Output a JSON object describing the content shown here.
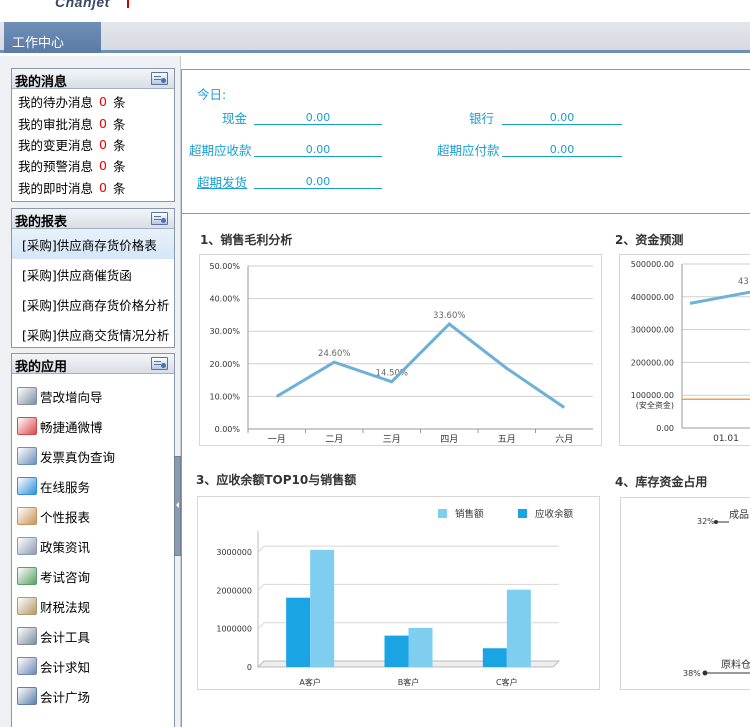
{
  "app": {
    "logo": "Chanjet",
    "tab": "工作中心"
  },
  "messages": {
    "title": "我的消息",
    "items": [
      {
        "label": "我的待办消息",
        "count": "0",
        "unit": "条"
      },
      {
        "label": "我的审批消息",
        "count": "0",
        "unit": "条"
      },
      {
        "label": "我的变更消息",
        "count": "0",
        "unit": "条"
      },
      {
        "label": "我的预警消息",
        "count": "0",
        "unit": "条"
      },
      {
        "label": "我的即时消息",
        "count": "0",
        "unit": "条"
      }
    ]
  },
  "reports": {
    "title": "我的报表",
    "items": [
      "[采购]供应商存货价格表",
      "[采购]供应商催货函",
      "[采购]供应商存货价格分析",
      "[采购]供应商交货情况分析"
    ]
  },
  "apps": {
    "title": "我的应用",
    "items": [
      {
        "label": "营改增向导",
        "icon": "wizard-icon",
        "color": "#7f8fa3"
      },
      {
        "label": "畅捷通微博",
        "icon": "weibo-icon",
        "color": "#d9474a"
      },
      {
        "label": "发票真伪查询",
        "icon": "magnifier-icon",
        "color": "#6b8fb8"
      },
      {
        "label": "在线服务",
        "icon": "chat-bubble-icon",
        "color": "#2f8fd8"
      },
      {
        "label": "个性报表",
        "icon": "report-icon",
        "color": "#c7945a"
      },
      {
        "label": "政策资讯",
        "icon": "news-icon",
        "color": "#8a9bb0"
      },
      {
        "label": "考试咨询",
        "icon": "people-icon",
        "color": "#5aa064"
      },
      {
        "label": "财税法规",
        "icon": "book-icon",
        "color": "#b09a6a"
      },
      {
        "label": "会计工具",
        "icon": "calculator-icon",
        "color": "#7d8d9f"
      },
      {
        "label": "会计求知",
        "icon": "student-icon",
        "color": "#6f88b8"
      },
      {
        "label": "会计广场",
        "icon": "square-icon",
        "color": "#5f7fa8"
      }
    ]
  },
  "summary": {
    "today_label": "今日:",
    "fields": {
      "cash": {
        "label": "现金",
        "value": "0.00"
      },
      "bank": {
        "label": "银行",
        "value": "0.00"
      },
      "overdue_receivable": {
        "label": "超期应收款",
        "value": "0.00"
      },
      "overdue_payable": {
        "label": "超期应付款",
        "value": "0.00"
      },
      "overdue_delivery": {
        "label": "超期发货",
        "value": "0.00"
      }
    }
  },
  "chart_titles": [
    "1、销售毛利分析",
    "2、资金预测",
    "3、应收余额TOP10与销售额",
    "4、库存资金占用"
  ],
  "colors": {
    "accent": "#1a9dd0",
    "header": "#5b7aa6",
    "count": "#e00000"
  },
  "chart_data": [
    {
      "type": "line",
      "title": "1、销售毛利分析",
      "categories": [
        "一月",
        "二月",
        "三月",
        "四月",
        "五月",
        "六月"
      ],
      "values": [
        10.0,
        20.5,
        14.5,
        32.2,
        18.6,
        6.6
      ],
      "labels": [
        "",
        "24.60%",
        "14.50%",
        "33.60%",
        "",
        ""
      ],
      "yticks": [
        "0.00%",
        "10.00%",
        "20.00%",
        "30.00%",
        "40.00%",
        "50.00%"
      ],
      "ylim": [
        0,
        50
      ],
      "color": "#6fb0d8",
      "grid": true
    },
    {
      "type": "line",
      "title": "2、资金预测",
      "categories": [
        "01.01"
      ],
      "yticks": [
        "0.00",
        "100000.00",
        "200000.00",
        "300000.00",
        "400000.00",
        "500000.00"
      ],
      "ylim": [
        0,
        500000
      ],
      "safety_label": "(安全资金)",
      "safety_value": 100000,
      "series_values": [
        380000,
        420000
      ],
      "point_label": "43",
      "grid": true
    },
    {
      "type": "bar",
      "title": "3、应收余额TOP10与销售额",
      "categories": [
        "A客户",
        "B客户",
        "C客户"
      ],
      "series": [
        {
          "name": "应收余额",
          "values": [
            1810000,
            820000,
            490000
          ],
          "color": "#1aa4e3"
        },
        {
          "name": "销售额",
          "values": [
            3060000,
            1020000,
            2020000
          ],
          "color": "#7fcef0"
        }
      ],
      "yticks": [
        "0",
        "1000000",
        "2000000",
        "3000000"
      ],
      "ylim": [
        0,
        3500000
      ],
      "legend": "top-right"
    },
    {
      "type": "pie",
      "title": "4、库存资金占用",
      "slices": [
        {
          "label": "成品",
          "percent": "32%"
        },
        {
          "label": "原料仓",
          "percent": "38%"
        }
      ]
    }
  ]
}
